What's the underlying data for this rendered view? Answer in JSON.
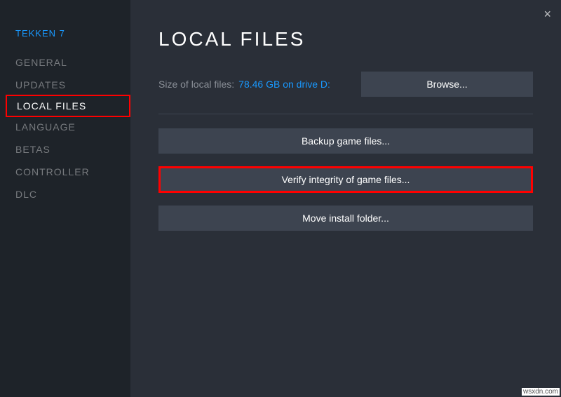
{
  "game_title": "TEKKEN 7",
  "sidebar": {
    "items": [
      {
        "label": "GENERAL",
        "active": false
      },
      {
        "label": "UPDATES",
        "active": false
      },
      {
        "label": "LOCAL FILES",
        "active": true
      },
      {
        "label": "LANGUAGE",
        "active": false
      },
      {
        "label": "BETAS",
        "active": false
      },
      {
        "label": "CONTROLLER",
        "active": false
      },
      {
        "label": "DLC",
        "active": false
      }
    ]
  },
  "main": {
    "title": "LOCAL FILES",
    "size_label": "Size of local files:",
    "size_value": "78.46 GB on drive D:",
    "browse_label": "Browse...",
    "backup_label": "Backup game files...",
    "verify_label": "Verify integrity of game files...",
    "move_label": "Move install folder..."
  },
  "close_glyph": "×",
  "watermark": "wsxdn.com"
}
